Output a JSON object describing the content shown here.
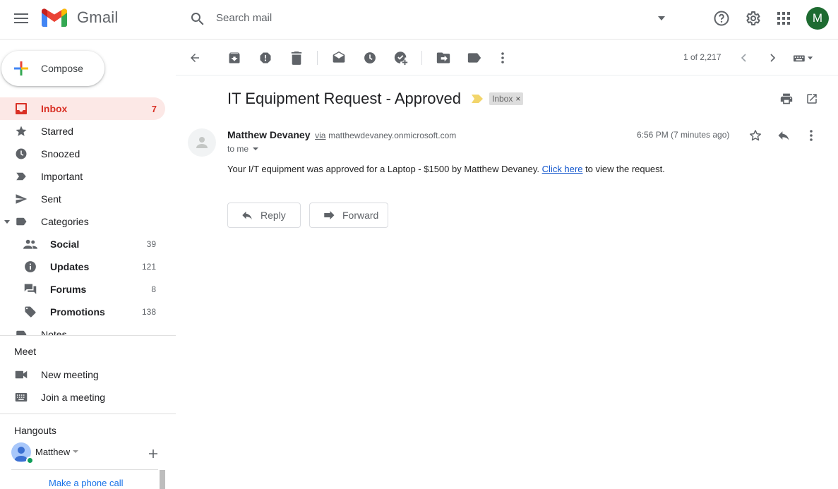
{
  "header": {
    "app_name": "Gmail",
    "search_placeholder": "Search mail",
    "avatar_letter": "M"
  },
  "compose": {
    "label": "Compose"
  },
  "sidebar": {
    "items": [
      {
        "label": "Inbox",
        "count": "7",
        "icon": "inbox-icon"
      },
      {
        "label": "Starred",
        "count": "",
        "icon": "star-icon"
      },
      {
        "label": "Snoozed",
        "count": "",
        "icon": "clock-icon"
      },
      {
        "label": "Important",
        "count": "",
        "icon": "important-icon"
      },
      {
        "label": "Sent",
        "count": "",
        "icon": "send-icon"
      },
      {
        "label": "Categories",
        "count": "",
        "icon": "label-icon"
      }
    ],
    "categories": [
      {
        "label": "Social",
        "count": "39",
        "icon": "people-icon"
      },
      {
        "label": "Updates",
        "count": "121",
        "icon": "info-icon"
      },
      {
        "label": "Forums",
        "count": "8",
        "icon": "forum-icon"
      },
      {
        "label": "Promotions",
        "count": "138",
        "icon": "tag-icon"
      }
    ],
    "notes_label": "Notes"
  },
  "meet": {
    "title": "Meet",
    "new_meeting": "New meeting",
    "join_meeting": "Join a meeting"
  },
  "hangouts": {
    "title": "Hangouts",
    "user": "Matthew",
    "phone_call": "Make a phone call"
  },
  "toolbar": {
    "pager": "1 of 2,217"
  },
  "message": {
    "subject": "IT Equipment Request - Approved",
    "label": "Inbox",
    "sender_name": "Matthew Devaney",
    "via": "via",
    "via_domain": "matthewdevaney.onmicrosoft.com",
    "to": "to me",
    "time": "6:56 PM (7 minutes ago)",
    "body_before": "Your I/T equipment was approved for a Laptop - $1500 by Matthew Devaney. ",
    "body_link": "Click here",
    "body_after": " to view the request."
  },
  "actions": {
    "reply": "Reply",
    "forward": "Forward"
  },
  "colors": {
    "accent_red": "#d93025",
    "active_bg": "#fce8e6",
    "avatar_green": "#1e6b31",
    "link_blue": "#1155cc"
  }
}
